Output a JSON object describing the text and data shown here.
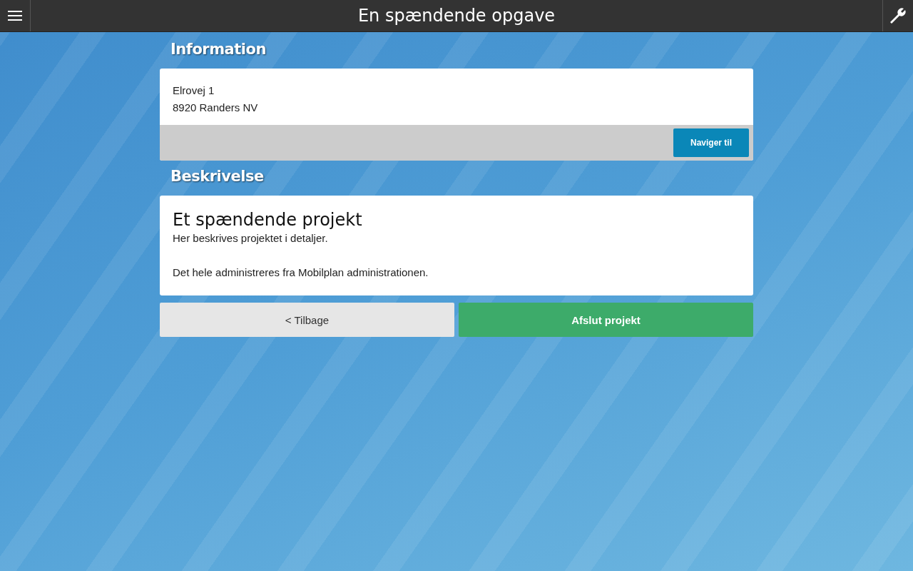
{
  "header": {
    "title": "En spændende opgave"
  },
  "information": {
    "heading": "Information",
    "address_lines": [
      "Elrovej 1",
      "8920 Randers NV"
    ],
    "navigate_button": "Naviger til"
  },
  "description": {
    "heading": "Beskrivelse",
    "title": "Et spændende projekt",
    "paragraphs": [
      "Her beskrives projektet i detaljer.",
      "Det hele administreres fra Mobilplan administrationen."
    ]
  },
  "buttons": [
    {
      "label": "< Tilbage",
      "kind": "secondary"
    },
    {
      "label": "Afslut projekt",
      "kind": "primary"
    }
  ]
}
